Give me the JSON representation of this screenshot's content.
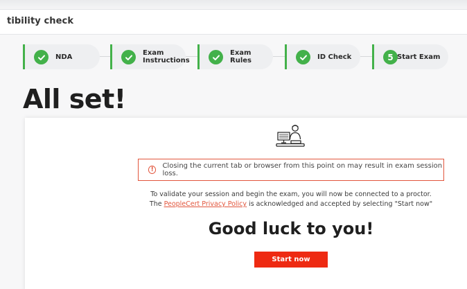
{
  "window": {
    "title": "tibility check"
  },
  "stepper": {
    "steps": [
      {
        "label": "NDA",
        "status": "done",
        "icon": "check-icon"
      },
      {
        "label": "Exam\nInstructions",
        "status": "done",
        "icon": "check-icon"
      },
      {
        "label": "Exam\nRules",
        "status": "done",
        "icon": "check-icon"
      },
      {
        "label": "ID Check",
        "status": "done",
        "icon": "check-icon"
      },
      {
        "label": "Start Exam",
        "status": "current",
        "number": "5"
      }
    ]
  },
  "main": {
    "title": "All set!",
    "warning": {
      "icon": "exclamation-circle-icon",
      "text": "Closing the current tab or browser from this point on may result in exam session loss."
    },
    "info": {
      "line1": "To validate your session and begin the exam, you will now be connected to a proctor.",
      "line2_prefix": "The ",
      "link": "PeopleCert Privacy Policy",
      "line2_suffix": " is acknowledged and accepted by selecting \"Start now\""
    },
    "good_luck": "Good luck to you!",
    "start_button": "Start now"
  },
  "colors": {
    "accent_green": "#43b14a",
    "warning_red": "#e2553c",
    "button_red": "#ee2a12"
  }
}
